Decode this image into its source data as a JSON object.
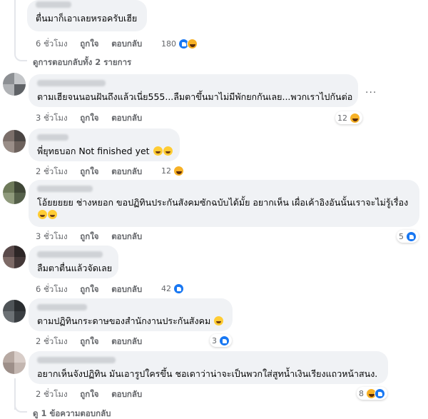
{
  "comments": [
    {
      "text": "ตื่นมาก็เอาเลยหรอครับเฮีย",
      "time": "6 ชั่วโมง",
      "like": "ถูกใจ",
      "reply": "ตอบกลับ",
      "reactions": "180",
      "reaction_icons": [
        "like-icon",
        "haha-icon"
      ]
    },
    {
      "text": "ตามเฮียจนนอนฝันถึงแล้วเนี่ย555...ลืมตาขึ้นมาไม่มีพักยกกันเลย...พวกเราไปกันต่อ",
      "time": "3 ชั่วโมง",
      "like": "ถูกใจ",
      "reply": "ตอบกลับ",
      "reactions": "12",
      "reaction_icons": [
        "haha-icon"
      ]
    },
    {
      "text": "พี่ยุทธบอก Not finished yet",
      "time": "2 ชั่วโมง",
      "like": "ถูกใจ",
      "reply": "ตอบกลับ",
      "reactions": "12",
      "reaction_icons": [
        "haha-icon"
      ]
    },
    {
      "text": "โอ้ยยยยย ช่างหยอก ขอปฏิทินประกันสังคมซักฉบับได้มั้ย อยากเห็น เผื่อเค้าอิงอันนั้นเราจะไม่รู้เรื่อง",
      "time": "3 ชั่วโมง",
      "like": "ถูกใจ",
      "reply": "ตอบกลับ",
      "reactions": "5",
      "reaction_icons": [
        "like-icon"
      ]
    },
    {
      "text": "ลืมตาตื่นแล้วจัดเลย",
      "time": "6 ชั่วโมง",
      "like": "ถูกใจ",
      "reply": "ตอบกลับ",
      "reactions": "42",
      "reaction_icons": [
        "like-icon"
      ]
    },
    {
      "text": "ตามปฏิทินกระดาษของสำนักงานประกันสังคม",
      "time": "2 ชั่วโมง",
      "like": "ถูกใจ",
      "reply": "ตอบกลับ",
      "reactions": "3",
      "reaction_icons": [
        "like-icon"
      ]
    },
    {
      "text": "อยากเห็นจังปฏิทิน มันเอารูปใครขึ้น ชอเดาว่าน่าจะเป็นพวกใส่สูทน้ำเงินเรียงแถวหน้าสนง.",
      "time": "2 ชั่วโมง",
      "like": "ถูกใจ",
      "reply": "ตอบกลับ",
      "reactions": "8",
      "reaction_icons": [
        "haha-icon",
        "like-icon"
      ]
    }
  ],
  "view_replies_top": "ดูการตอบกลับทั้ง 2 รายการ",
  "view_replies_bottom": "ดู 1 ข้อความตอบกลับ",
  "more_icon": "more-horizontal-icon",
  "colors": {
    "bubble": "#f0f2f5",
    "meta": "#65676b",
    "like_blue": "#1877f2",
    "haha_yellow": "#f7b125"
  }
}
